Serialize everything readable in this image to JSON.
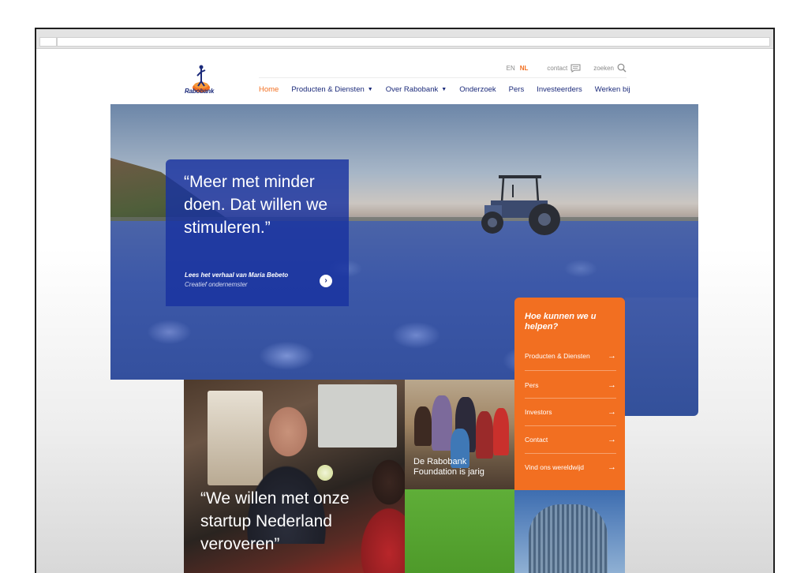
{
  "header": {
    "logo_text": "Rabobank",
    "languages": [
      {
        "code": "EN",
        "active": false
      },
      {
        "code": "NL",
        "active": true
      }
    ],
    "contact_label": "contact",
    "search_label": "zoeken"
  },
  "nav": [
    {
      "label": "Home",
      "active": true,
      "dropdown": false
    },
    {
      "label": "Producten & Diensten",
      "active": false,
      "dropdown": true
    },
    {
      "label": "Over Rabobank",
      "active": false,
      "dropdown": true
    },
    {
      "label": "Onderzoek",
      "active": false,
      "dropdown": false
    },
    {
      "label": "Pers",
      "active": false,
      "dropdown": false
    },
    {
      "label": "Investeerders",
      "active": false,
      "dropdown": false
    },
    {
      "label": "Werken bij",
      "active": false,
      "dropdown": false
    }
  ],
  "hero": {
    "quote": "“Meer met minder doen. Dat willen we stimuleren.”",
    "story_link": "Lees het verhaal van Maria Bebeto",
    "story_sub": "Creatief ondernemster"
  },
  "help": {
    "title": "Hoe kunnen we u helpen?",
    "items": [
      {
        "label": "Producten & Diensten"
      },
      {
        "label": "Pers"
      },
      {
        "label": "Investors"
      },
      {
        "label": "Contact"
      },
      {
        "label": "Vind ons wereldwijd"
      }
    ]
  },
  "tiles": {
    "man_quote": "“We willen met onze startup Nederland veroveren”",
    "kids_text": "De Rabobank Foundation is jarig"
  },
  "colors": {
    "brand_blue": "#1b2a7a",
    "brand_orange": "#f26f21",
    "panel_blue": "#1932a0",
    "green_tile": "#5fae38"
  }
}
